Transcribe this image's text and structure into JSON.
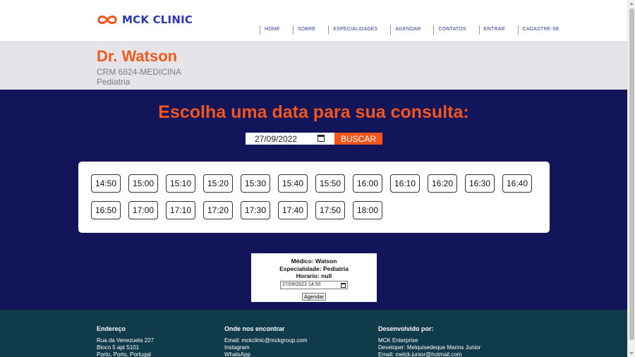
{
  "header": {
    "logo_text": "MCK CLINIC",
    "nav": [
      "HOME",
      "SOBRE",
      "ESPECIALIDADES",
      "AGENDAR",
      "CONTATOS",
      "ENTRAR",
      "CADASTRE-SE"
    ]
  },
  "doctor": {
    "name": "Dr. Watson",
    "crm": "CRM 6824-MEDICINA",
    "specialty": "Pediatria"
  },
  "booking": {
    "title": "Escolha uma data para sua consulta:",
    "date_value": "27/09/2022",
    "search_label": "BUSCAR",
    "slots": [
      "14:50",
      "15:00",
      "15:10",
      "15:20",
      "15:30",
      "15:40",
      "15:50",
      "16:00",
      "16:10",
      "16:20",
      "16:30",
      "16:40",
      "16:50",
      "17:00",
      "17:10",
      "17:20",
      "17:30",
      "17:40",
      "17:50",
      "18:00"
    ]
  },
  "summary": {
    "doctor_line": "Médico: Watson",
    "specialty_line": "Especialidade: Pediatria",
    "time_line": "Horario: null",
    "datetime_value": "27/09/2022  14:50",
    "button_label": "Agendar"
  },
  "footer": {
    "address": {
      "heading": "Endereço",
      "lines": [
        "Rua da Venezuela 227",
        "Bloco 5 apt 5101",
        "Porto, Porto, Portugal"
      ]
    },
    "contact": {
      "heading": "Onde nos encontrar",
      "lines": [
        "Email: mckclinic@mckgroup.com",
        "Instagram",
        "WhatsApp"
      ]
    },
    "developer": {
      "heading": "Desenvolvido por:",
      "lines": [
        "MCK Enterprise",
        "Developer: Melquisedeque Marins Junior",
        "Email: melck.junior@hotmail.com"
      ]
    }
  },
  "colors": {
    "brand_blue": "#2b38b5",
    "accent_orange": "#f2561d",
    "main_bg": "#13155a",
    "footer_bg": "#0f3b4a"
  },
  "icons": {
    "logo": "infinity-icon",
    "calendar": "calendar-icon"
  }
}
